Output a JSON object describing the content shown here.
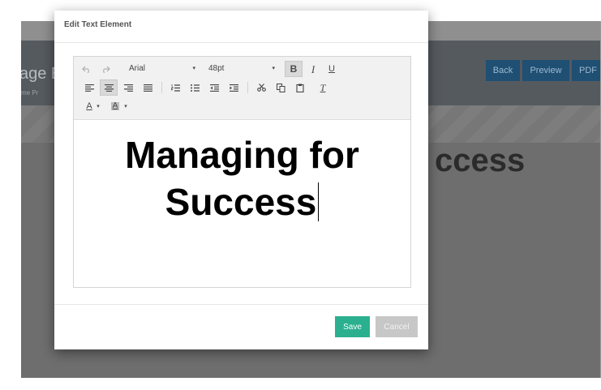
{
  "background_app": {
    "title_fragment": "age E",
    "breadcrumb_fragment": "me   Pr",
    "buttons": [
      "Back",
      "Preview",
      "PDF"
    ],
    "heading_fragment": "ccess"
  },
  "modal": {
    "title": "Edit Text Element",
    "toolbar": {
      "font_family": "Arial",
      "font_size": "48pt",
      "bold_label": "B",
      "italic_label": "I",
      "underline_label": "U",
      "clear_format_label": "T",
      "font_color_label": "A",
      "highlight_label": "A",
      "caret": "▾",
      "icons": [
        "undo-icon",
        "redo-icon",
        "align-left-icon",
        "align-center-icon",
        "align-right-icon",
        "align-justify-icon",
        "ordered-list-icon",
        "unordered-list-icon",
        "outdent-icon",
        "indent-icon",
        "cut-icon",
        "copy-icon",
        "paste-icon",
        "clear-format-icon",
        "font-color-icon",
        "highlight-color-icon"
      ]
    },
    "content_lines": [
      "Managing for",
      "Success"
    ],
    "save_label": "Save",
    "cancel_label": "Cancel",
    "colors": {
      "save": "#2bb08f",
      "cancel": "#c7c7c7",
      "app_button": "#1f4f73"
    }
  }
}
